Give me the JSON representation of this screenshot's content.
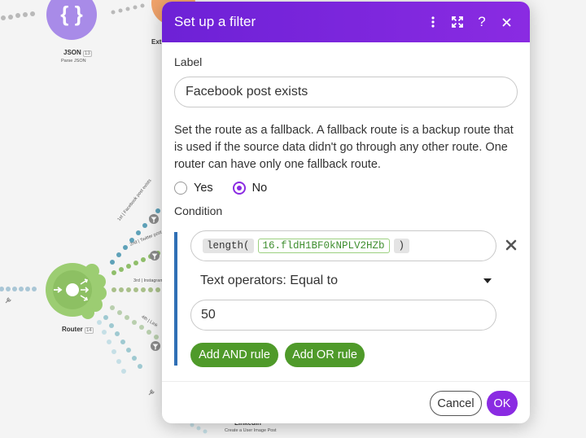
{
  "canvas": {
    "modules": [
      {
        "name": "JSON",
        "badge": "13",
        "subtitle": "Parse JSON"
      },
      {
        "name": "Ext",
        "subtitle": ""
      },
      {
        "name": "Router",
        "badge": "14",
        "subtitle": ""
      },
      {
        "name": "LinkedIn",
        "subtitle": "Create a User Image Post"
      }
    ],
    "routes": [
      {
        "tag": "1st",
        "label": "Facebook post exists"
      },
      {
        "tag": "2nd",
        "label": "Twitter post"
      },
      {
        "tag": "3rd",
        "label": "Instagram"
      },
      {
        "tag": "4th",
        "label": "Link"
      }
    ],
    "colors": {
      "json_module": "#a88be8",
      "router_module": "#9ccd72",
      "ext_module": "#f0a36b"
    }
  },
  "dialog": {
    "title": "Set up a filter",
    "header_icons": [
      "more-vertical-icon",
      "expand-icon",
      "help-icon",
      "close-icon"
    ],
    "help_label": "?",
    "label_heading": "Label",
    "label_value": "Facebook post exists",
    "fallback_text": "Set the route as a fallback. A fallback route is a backup route that is used if the source data didn't go through any other route. One router can have only one fallback route.",
    "fallback_options": {
      "yes": "Yes",
      "no": "No",
      "selected": "No"
    },
    "condition_heading": "Condition",
    "condition": {
      "function": "length(",
      "variable": "16.fldH1BF0kNPLV2HZb",
      "close": ")",
      "operator": "Text operators: Equal to",
      "value": "50"
    },
    "add_and_rule": "Add AND rule",
    "add_or_rule": "Add OR rule",
    "cancel": "Cancel",
    "ok": "OK",
    "colors": {
      "header_start": "#6d21d6",
      "header_end": "#8a2be2",
      "accent": "#8a2be2",
      "rule_button": "#4f9a2a",
      "condition_bar": "#2f6fb5",
      "variable_text": "#3e8e2f"
    }
  }
}
